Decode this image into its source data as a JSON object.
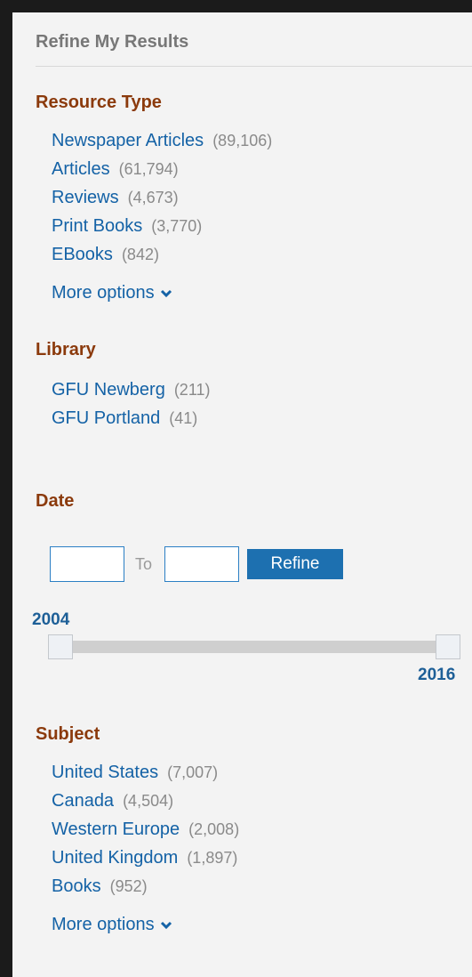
{
  "panel_title": "Refine My Results",
  "resource_type": {
    "title": "Resource Type",
    "items": [
      {
        "label": "Newspaper Articles",
        "count": "(89,106)"
      },
      {
        "label": "Articles",
        "count": "(61,794)"
      },
      {
        "label": "Reviews",
        "count": "(4,673)"
      },
      {
        "label": "Print Books",
        "count": "(3,770)"
      },
      {
        "label": "EBooks",
        "count": "(842)"
      }
    ],
    "more_options": "More options"
  },
  "library": {
    "title": "Library",
    "items": [
      {
        "label": "GFU Newberg",
        "count": "(211)"
      },
      {
        "label": "GFU Portland",
        "count": "(41)"
      }
    ]
  },
  "date": {
    "title": "Date",
    "from_value": "",
    "to_label": "To",
    "to_value": "",
    "refine_label": "Refine",
    "slider_min": "2004",
    "slider_max": "2016"
  },
  "subject": {
    "title": "Subject",
    "items": [
      {
        "label": "United States",
        "count": "(7,007)"
      },
      {
        "label": "Canada",
        "count": "(4,504)"
      },
      {
        "label": "Western Europe",
        "count": "(2,008)"
      },
      {
        "label": "United Kingdom",
        "count": "(1,897)"
      },
      {
        "label": "Books",
        "count": "(952)"
      }
    ],
    "more_options": "More options"
  },
  "colors": {
    "section_title": "#8b3a0c",
    "link": "#1462a6",
    "count": "#8a8a8a",
    "button": "#1d70b0"
  },
  "icons": {
    "more_options": "chevron-down-icon"
  }
}
